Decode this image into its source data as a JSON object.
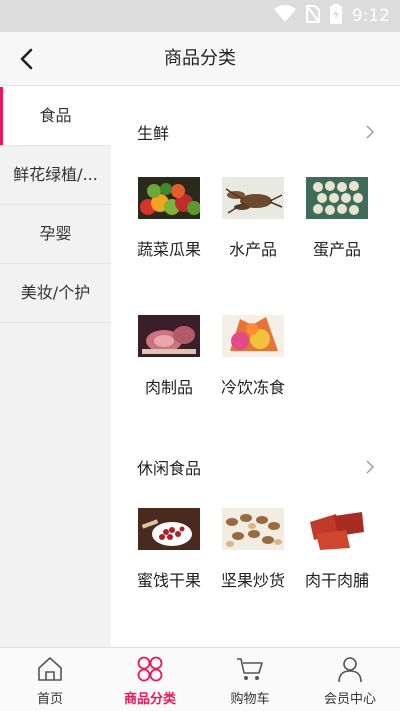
{
  "status": {
    "time": "9:12",
    "wifi_icon": "wifi-icon",
    "sim_icon": "no-sim-icon",
    "battery_icon": "battery-charging-icon"
  },
  "header": {
    "title": "商品分类",
    "back_icon": "chevron-left-icon"
  },
  "sidebar": {
    "items": [
      {
        "label": "食品",
        "active": true
      },
      {
        "label": "鲜花绿植/...",
        "active": false
      },
      {
        "label": "孕婴",
        "active": false
      },
      {
        "label": "美妆/个护",
        "active": false
      }
    ]
  },
  "sections": [
    {
      "title": "生鲜",
      "more_icon": "chevron-right-icon",
      "products": [
        {
          "label": "蔬菜瓜果",
          "image": "vegetables-image"
        },
        {
          "label": "水产品",
          "image": "crayfish-image"
        },
        {
          "label": "蛋产品",
          "image": "eggs-image"
        },
        {
          "label": "肉制品",
          "image": "meat-image"
        },
        {
          "label": "冷饮冻食",
          "image": "frozen-food-image"
        }
      ]
    },
    {
      "title": "休闲食品",
      "more_icon": "chevron-right-icon",
      "products": [
        {
          "label": "蜜饯干果",
          "image": "dried-fruit-image"
        },
        {
          "label": "坚果炒货",
          "image": "nuts-image"
        },
        {
          "label": "肉干肉脯",
          "image": "jerky-image"
        }
      ]
    }
  ],
  "tabbar": {
    "tabs": [
      {
        "label": "首页",
        "icon": "home-icon",
        "active": false
      },
      {
        "label": "商品分类",
        "icon": "category-icon",
        "active": true
      },
      {
        "label": "购物车",
        "icon": "cart-icon",
        "active": false
      },
      {
        "label": "会员中心",
        "icon": "user-icon",
        "active": false
      }
    ]
  },
  "colors": {
    "accent": "#e8195c",
    "sidebar_bg": "#f2f2f2",
    "statusbar": "#dcdcdc"
  }
}
